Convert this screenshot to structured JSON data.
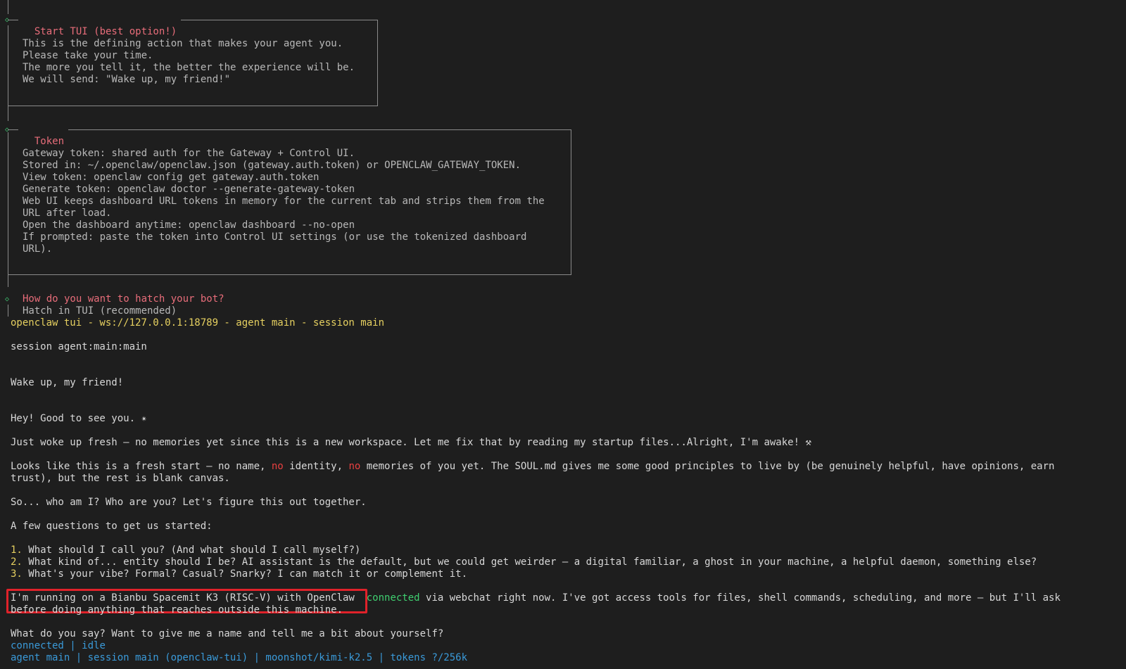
{
  "start_tui": {
    "title": "Start TUI (best option!)",
    "lines": [
      "This is the defining action that makes your agent you.",
      "Please take your time.",
      "The more you tell it, the better the experience will be.",
      "We will send: \"Wake up, my friend!\""
    ]
  },
  "token": {
    "title": "Token",
    "lines": [
      "Gateway token: shared auth for the Gateway + Control UI.",
      "Stored in: ~/.openclaw/openclaw.json (gateway.auth.token) or OPENCLAW_GATEWAY_TOKEN.",
      "View token: openclaw config get gateway.auth.token",
      "Generate token: openclaw doctor --generate-gateway-token",
      "Web UI keeps dashboard URL tokens in memory for the current tab and strips them from the",
      "URL after load.",
      "Open the dashboard anytime: openclaw dashboard --no-open",
      "If prompted: paste the token into Control UI settings (or use the tokenized dashboard",
      "URL)."
    ]
  },
  "hatch": {
    "question": "How do you want to hatch your bot?",
    "answer": "Hatch in TUI (recommended)"
  },
  "tui_header": "openclaw tui - ws://127.0.0.1:18789 - agent main - session main",
  "session_line": "session agent:main:main",
  "user_message": "Wake up, my friend!",
  "reply": {
    "greeting": "Hey! Good to see you. ✴",
    "wake": "Just woke up fresh — no memories yet since this is a new workspace. Let me fix that by reading my startup files...Alright, I'm awake! ⚒",
    "fresh_a": "Looks like this is a fresh start — no name, ",
    "fresh_no1": "no",
    "fresh_b": " identity, ",
    "fresh_no2": "no",
    "fresh_c": " memories of you yet. The SOUL.md gives me some good principles to live by (be genuinely helpful, have opinions, earn",
    "fresh_d": "trust), but the rest is blank canvas.",
    "who": "So... who am I? Who are you? Let's figure this out together.",
    "few": "A few questions to get us started:",
    "q1_num": "1.",
    "q1": " What should I call you? (And what should I call myself?)",
    "q2_num": "2.",
    "q2": " What kind of... entity should I be? AI assistant is the default, but we could get weirder — a digital familiar, a ghost in your machine, a helpful daemon, something else?",
    "q3_num": "3.",
    "q3": " What's your vibe? Formal? Casual? Snarky? I can match it or complement it.",
    "running_hl": "I'm running on a Bianbu Spacemit K3 (RISC-V) with OpenClaw",
    "running_connected": "connected",
    "running_rest": " via webchat right now. I've got access tools for files, shell commands, scheduling, and more — but I'll ask",
    "running_cont": "before doing anything that reaches outside this machine.",
    "closing": "What do you say? Want to give me a name and tell me a bit about yourself?"
  },
  "status": {
    "connected": "connected",
    "sep1": " | ",
    "idle": "idle",
    "footer": "agent main | session main (openclaw-tui) | moonshot/kimi-k2.5 | tokens ?/256k"
  },
  "colors": {
    "background": "#1e1e1e",
    "text": "#d8d8d8",
    "section_title": "#e86d7a",
    "header_yellow": "#e6d060",
    "connected_green": "#3fcf70",
    "status_blue": "#3a9ad9",
    "highlight_red": "#e0222a"
  }
}
